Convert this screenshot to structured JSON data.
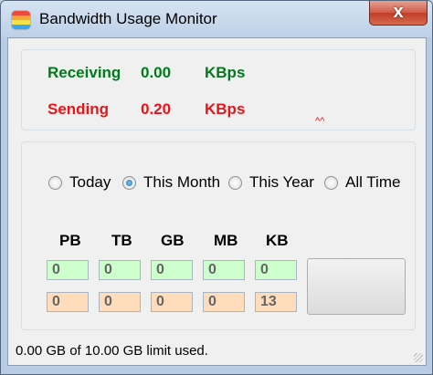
{
  "window": {
    "title": "Bandwidth Usage Monitor",
    "close_label": "x"
  },
  "rates": {
    "receiving": {
      "label": "Receiving",
      "value": "0.00",
      "unit": "KBps",
      "color": "#007a1c"
    },
    "sending": {
      "label": "Sending",
      "value": "0.20",
      "unit": "KBps",
      "color": "#e8141a"
    },
    "marker": "^^"
  },
  "period": {
    "options": [
      {
        "label": "Today",
        "checked": false
      },
      {
        "label": "This Month",
        "checked": true
      },
      {
        "label": "This Year",
        "checked": false
      },
      {
        "label": "All Time",
        "checked": false
      }
    ]
  },
  "usage": {
    "columns": [
      "PB",
      "TB",
      "GB",
      "MB",
      "KB"
    ],
    "received": [
      "0",
      "0",
      "0",
      "0",
      "0"
    ],
    "sent": [
      "0",
      "0",
      "0",
      "0",
      "13"
    ]
  },
  "status": {
    "text": "0.00 GB of 10.00 GB limit used."
  }
}
